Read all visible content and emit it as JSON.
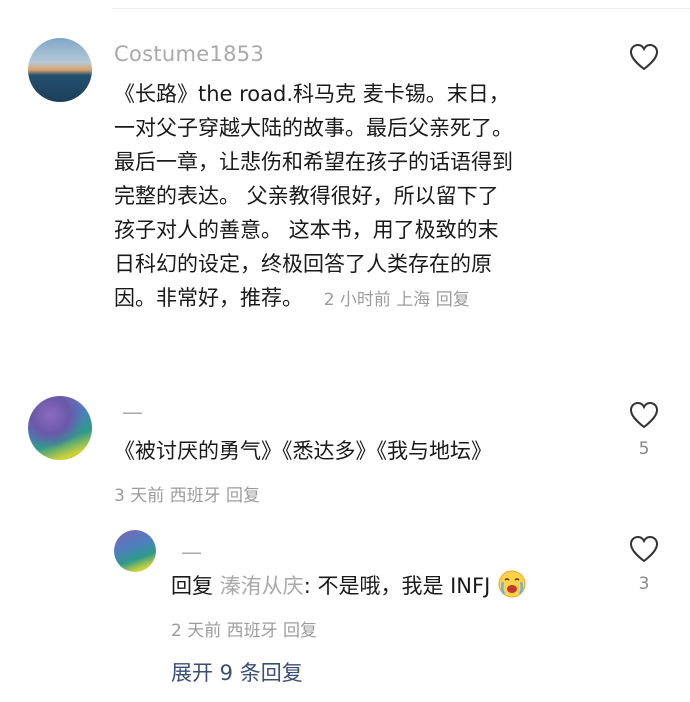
{
  "comments": [
    {
      "username": "Costume1853",
      "lines": [
        "《长路》the road.科马克 麦卡锡。末日，",
        "一对父子穿越大陆的故事。最后父亲死了。",
        "最后一章，让悲伤和希望在孩子的话语得到",
        "完整的表达。 父亲教得很好，所以留下了",
        "孩子对人的善意。 这本书，用了极致的末",
        "日科幻的设定，终极回答了人类存在的原",
        "因。非常好，推荐。"
      ],
      "meta": "2 小时前 上海 回复",
      "like_count": ""
    },
    {
      "username": "—",
      "text": "《被讨厌的勇气》《悉达多》《我与地坛》",
      "meta": "3 天前 西班牙 回复",
      "like_count": "5"
    }
  ],
  "reply": {
    "username": "—",
    "prefix": "回复",
    "reply_to": "溱洧从庆",
    "text": ": 不是哦，我是 INFJ",
    "emoji": "crying-face-icon",
    "meta": "2 天前 西班牙 回复",
    "like_count": "3"
  },
  "expand_label": "展开 9 条回复",
  "colors": {
    "accent": "#3a4e76",
    "muted": "#9c9c9c"
  }
}
